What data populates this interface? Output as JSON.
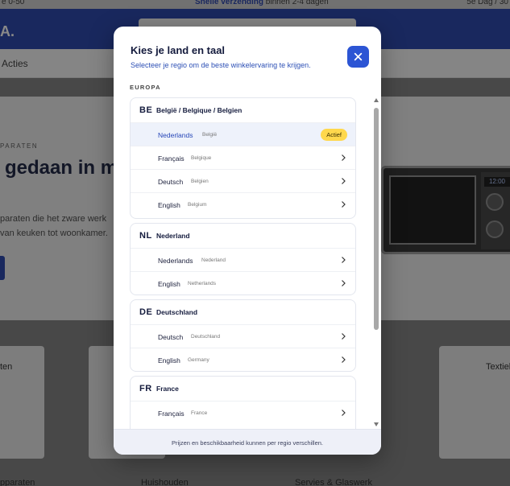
{
  "background": {
    "topbar": {
      "left": "e 0-50",
      "center_bold": "Snelle verzending",
      "center_rest": " binnen 2-4 dagen",
      "right": "5e Dag / 30"
    },
    "logo_fragment": "A.",
    "nav_item": "Acties",
    "hero": {
      "kicker": "PARATEN",
      "headline": "gedaan in m",
      "line1": "paraten die het zware werk",
      "line2": "van keuken tot woonkamer."
    },
    "microwave_display": "12:00",
    "tiles": {
      "t1": "ten",
      "t2": "Textiel",
      "b1": "pparaten",
      "b2": "Huishouden",
      "b3": "Servies & Glaswerk"
    }
  },
  "modal": {
    "title": "Kies je land en taal",
    "subtitle": "Selecteer je regio om de beste winkelervaring te krijgen.",
    "region": "EUROPA",
    "active_badge": "Actief",
    "footer": "Prijzen en beschikbaarheid kunnen per regio verschillen.",
    "countries": [
      {
        "code": "BE",
        "name": "België / Belgique / Belgien",
        "languages": [
          {
            "label": "Nederlands",
            "region": "België",
            "active": true
          },
          {
            "label": "Français",
            "region": "Belgique"
          },
          {
            "label": "Deutsch",
            "region": "Belgien"
          },
          {
            "label": "English",
            "region": "Belgium"
          }
        ]
      },
      {
        "code": "NL",
        "name": "Nederland",
        "languages": [
          {
            "label": "Nederlands",
            "region": "Nederland"
          },
          {
            "label": "English",
            "region": "Netherlands"
          }
        ]
      },
      {
        "code": "DE",
        "name": "Deutschland",
        "languages": [
          {
            "label": "Deutsch",
            "region": "Deutschland"
          },
          {
            "label": "English",
            "region": "Germany"
          }
        ]
      },
      {
        "code": "FR",
        "name": "France",
        "languages": [
          {
            "label": "Français",
            "region": "France"
          }
        ]
      }
    ]
  },
  "colors": {
    "brand_blue": "#1f3da8",
    "close_button": "#2c55d4",
    "active_badge": "#ffd84d",
    "active_row": "#eef2fb"
  },
  "icons": {
    "close": "close-icon",
    "chevron": "chevron-right-icon"
  }
}
